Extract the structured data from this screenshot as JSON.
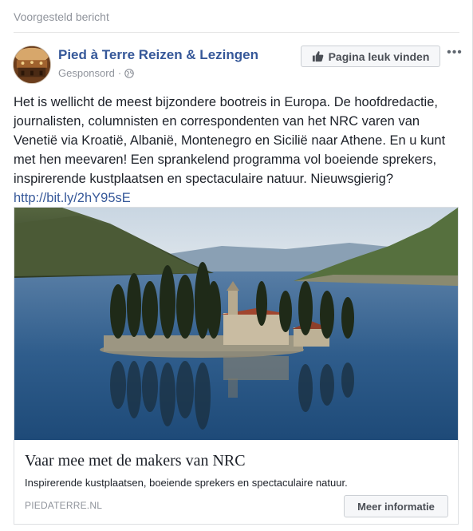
{
  "header": {
    "suggested_label": "Voorgesteld bericht"
  },
  "post": {
    "page_name": "Pied à Terre Reizen & Lezingen",
    "sponsored_label": "Gesponsord",
    "meta_separator": "·",
    "like_button_label": "Pagina leuk vinden",
    "more_label": "•••",
    "text": "Het is wellicht de meest bijzondere bootreis in Europa. De hoofdredactie, journalisten, columnisten en correspondenten van het NRC varen van Venetië via Kroatië, Albanië, Montenegro en Sicilië naar Athene. En u kunt met hen meevaren! Een sprankelend programma vol boeiende sprekers, inspirerende kustplaatsen en spectaculaire natuur. Nieuwsgierig?",
    "link_text": "http://bit.ly/2hY95sE"
  },
  "attachment": {
    "title": "Vaar mee met de makers van NRC",
    "description": "Inspirerende kustplaatsen, boeiende sprekers en spectaculaire natuur.",
    "domain": "PIEDATERRE.NL",
    "cta_label": "Meer informatie"
  },
  "icons": {
    "like": "thumbs-up-icon",
    "privacy": "globe-icon",
    "more": "more-icon"
  },
  "colors": {
    "link": "#365899",
    "muted": "#90949c",
    "text": "#1d2129",
    "button_bg": "#f6f7f9"
  }
}
